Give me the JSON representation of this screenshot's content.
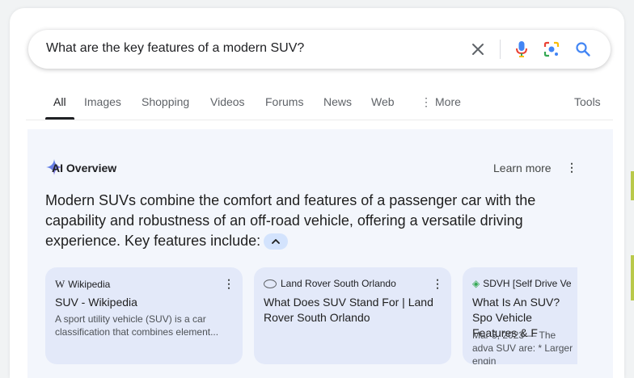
{
  "search": {
    "query": "What are the key features of a modern SUV?"
  },
  "tabs": [
    "All",
    "Images",
    "Shopping",
    "Videos",
    "Forums",
    "News",
    "Web",
    "More",
    "Tools"
  ],
  "ai_overview": {
    "title": "AI Overview",
    "learn_more": "Learn more",
    "summary": "Modern SUVs combine the comfort and features of a passenger car with the capability and robustness of an off-road vehicle, offering a versatile driving experience. Key features include:"
  },
  "sources": [
    {
      "site": "Wikipedia",
      "title": "SUV - Wikipedia",
      "snippet": "A sport utility vehicle (SUV) is a car classification that combines element..."
    },
    {
      "site": "Land Rover South Orlando",
      "title": "What Does SUV Stand For | Land Rover South Orlando",
      "snippet": ""
    },
    {
      "site": "SDVH [Self Drive Ve",
      "title": "What Is An SUV? Spo Vehicle Features & F",
      "snippet": "Mar 3, 2023 — The adva SUV are: * Larger engin"
    }
  ]
}
